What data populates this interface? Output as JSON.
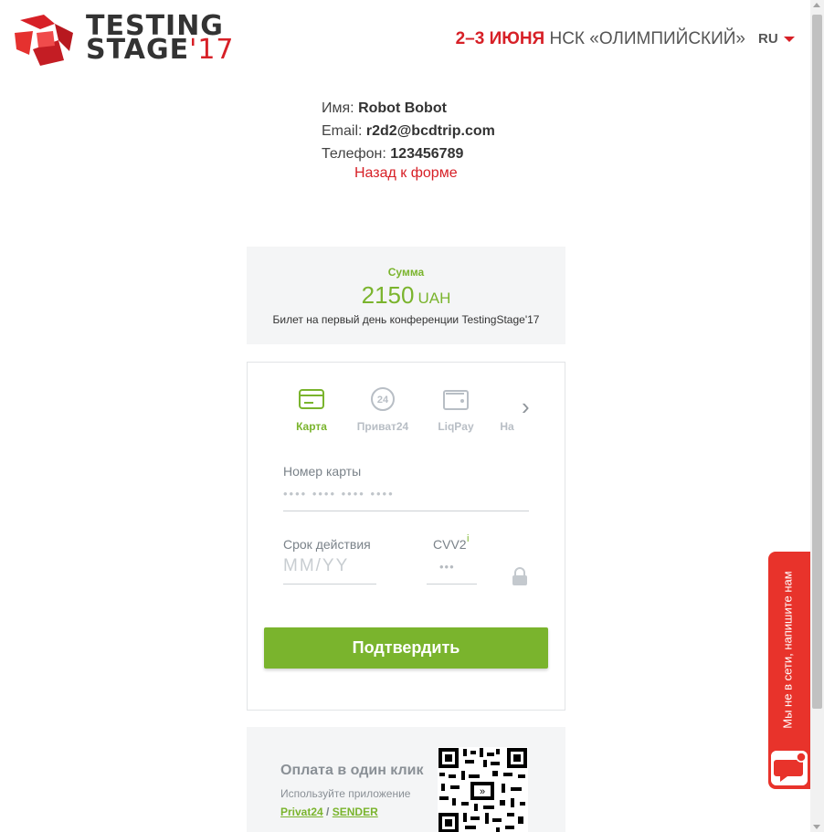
{
  "header": {
    "logo_line1": "TESTING",
    "logo_line2": "STAGE",
    "logo_year": "'17",
    "event_date": "2–3 ИЮНЯ",
    "event_venue": "НСК «ОЛИМПИЙСКИЙ»",
    "language": "RU"
  },
  "customer": {
    "name_label": "Имя:",
    "name_value": "Robot Bobot",
    "email_label": "Email:",
    "email_value": "r2d2@bcdtrip.com",
    "phone_label": "Телефон:",
    "phone_value": "123456789",
    "back_link": "Назад к форме"
  },
  "payment": {
    "sum_label": "Сумма",
    "amount": "2150",
    "currency": "UAH",
    "description": "Билет на первый день конференции TestingStage'17",
    "tabs": [
      {
        "label": "Карта",
        "icon": "card-icon",
        "active": true
      },
      {
        "label": "Приват24",
        "icon": "privat24-icon",
        "active": false
      },
      {
        "label": "LiqPay",
        "icon": "wallet-icon",
        "active": false
      },
      {
        "label": "На",
        "icon": "",
        "active": false
      }
    ],
    "card_number_label": "Номер карты",
    "card_number_placeholder": "•••• •••• •••• ••••",
    "expiry_label": "Срок действия",
    "expiry_placeholder": "MM/YY",
    "cvv_label": "CVV2",
    "cvv_info": "i",
    "cvv_placeholder": "•••",
    "confirm_button": "Подтвердить"
  },
  "one_click": {
    "title": "Оплата в один клик",
    "subtitle": "Используйте приложение",
    "link1": "Privat24",
    "separator": "/",
    "link2": "SENDER"
  },
  "chat": {
    "text": "Мы не в сети, напишите нам"
  },
  "colors": {
    "brand_red": "#d72027",
    "accent_green": "#7ab42d",
    "chat_red": "#e8332b"
  }
}
